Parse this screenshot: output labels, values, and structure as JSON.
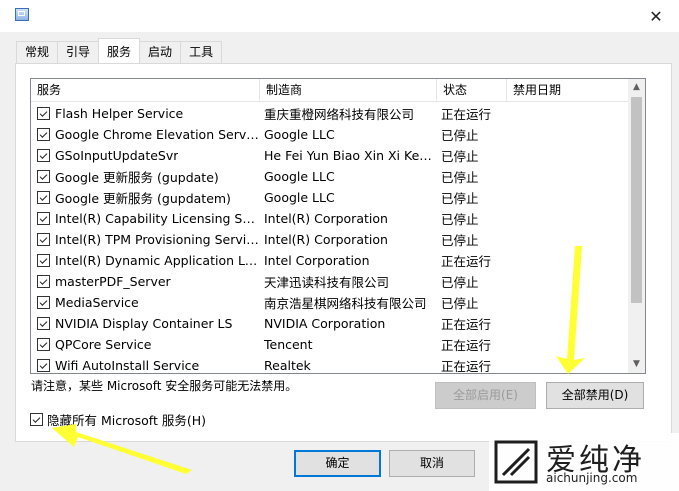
{
  "window": {
    "close_glyph": "✕"
  },
  "tabs": [
    {
      "label": "常规",
      "active": false
    },
    {
      "label": "引导",
      "active": false
    },
    {
      "label": "服务",
      "active": true
    },
    {
      "label": "启动",
      "active": false
    },
    {
      "label": "工具",
      "active": false
    }
  ],
  "columns": [
    "服务",
    "制造商",
    "状态",
    "禁用日期"
  ],
  "rows": [
    {
      "checked": true,
      "service": "Flash Helper Service",
      "maker": "重庆重橙网络科技有限公司",
      "status": "正在运行",
      "disabled_date": ""
    },
    {
      "checked": true,
      "service": "Google Chrome Elevation Service",
      "maker": "Google LLC",
      "status": "已停止",
      "disabled_date": ""
    },
    {
      "checked": true,
      "service": "GSoInputUpdateSvr",
      "maker": "He Fei Yun Biao Xin Xi Ke J...",
      "status": "已停止",
      "disabled_date": ""
    },
    {
      "checked": true,
      "service": "Google 更新服务 (gupdate)",
      "maker": "Google LLC",
      "status": "已停止",
      "disabled_date": ""
    },
    {
      "checked": true,
      "service": "Google 更新服务 (gupdatem)",
      "maker": "Google LLC",
      "status": "已停止",
      "disabled_date": ""
    },
    {
      "checked": true,
      "service": "Intel(R) Capability Licensing Servi...",
      "maker": "Intel(R) Corporation",
      "status": "已停止",
      "disabled_date": ""
    },
    {
      "checked": true,
      "service": "Intel(R) TPM Provisioning Service",
      "maker": "Intel(R) Corporation",
      "status": "已停止",
      "disabled_date": ""
    },
    {
      "checked": true,
      "service": "Intel(R) Dynamic Application Loa...",
      "maker": "Intel Corporation",
      "status": "正在运行",
      "disabled_date": ""
    },
    {
      "checked": true,
      "service": "masterPDF_Server",
      "maker": "天津迅读科技有限公司",
      "status": "已停止",
      "disabled_date": ""
    },
    {
      "checked": true,
      "service": "MediaService",
      "maker": "南京浩星棋网络科技有限公司",
      "status": "已停止",
      "disabled_date": ""
    },
    {
      "checked": true,
      "service": "NVIDIA Display Container LS",
      "maker": "NVIDIA Corporation",
      "status": "正在运行",
      "disabled_date": ""
    },
    {
      "checked": true,
      "service": "QPCore Service",
      "maker": "Tencent",
      "status": "正在运行",
      "disabled_date": ""
    },
    {
      "checked": true,
      "service": "Wifi AutoInstall Service",
      "maker": "Realtek",
      "status": "正在运行",
      "disabled_date": ""
    }
  ],
  "scroll": {
    "up": "▲",
    "down": "▼"
  },
  "note": "请注意，某些 Microsoft 安全服务可能无法禁用。",
  "buttons": {
    "enable_all": "全部启用(E)",
    "disable_all": "全部禁用(D)",
    "ok": "确定",
    "cancel": "取消"
  },
  "hide_ms": {
    "label": "隐藏所有 Microsoft 服务(H)",
    "checked": true
  },
  "watermark": {
    "cn": "爱纯净",
    "en": "aichunjing.com"
  },
  "colors": {
    "arrow": "#ffff33",
    "default_button_border": "#0078d7"
  }
}
